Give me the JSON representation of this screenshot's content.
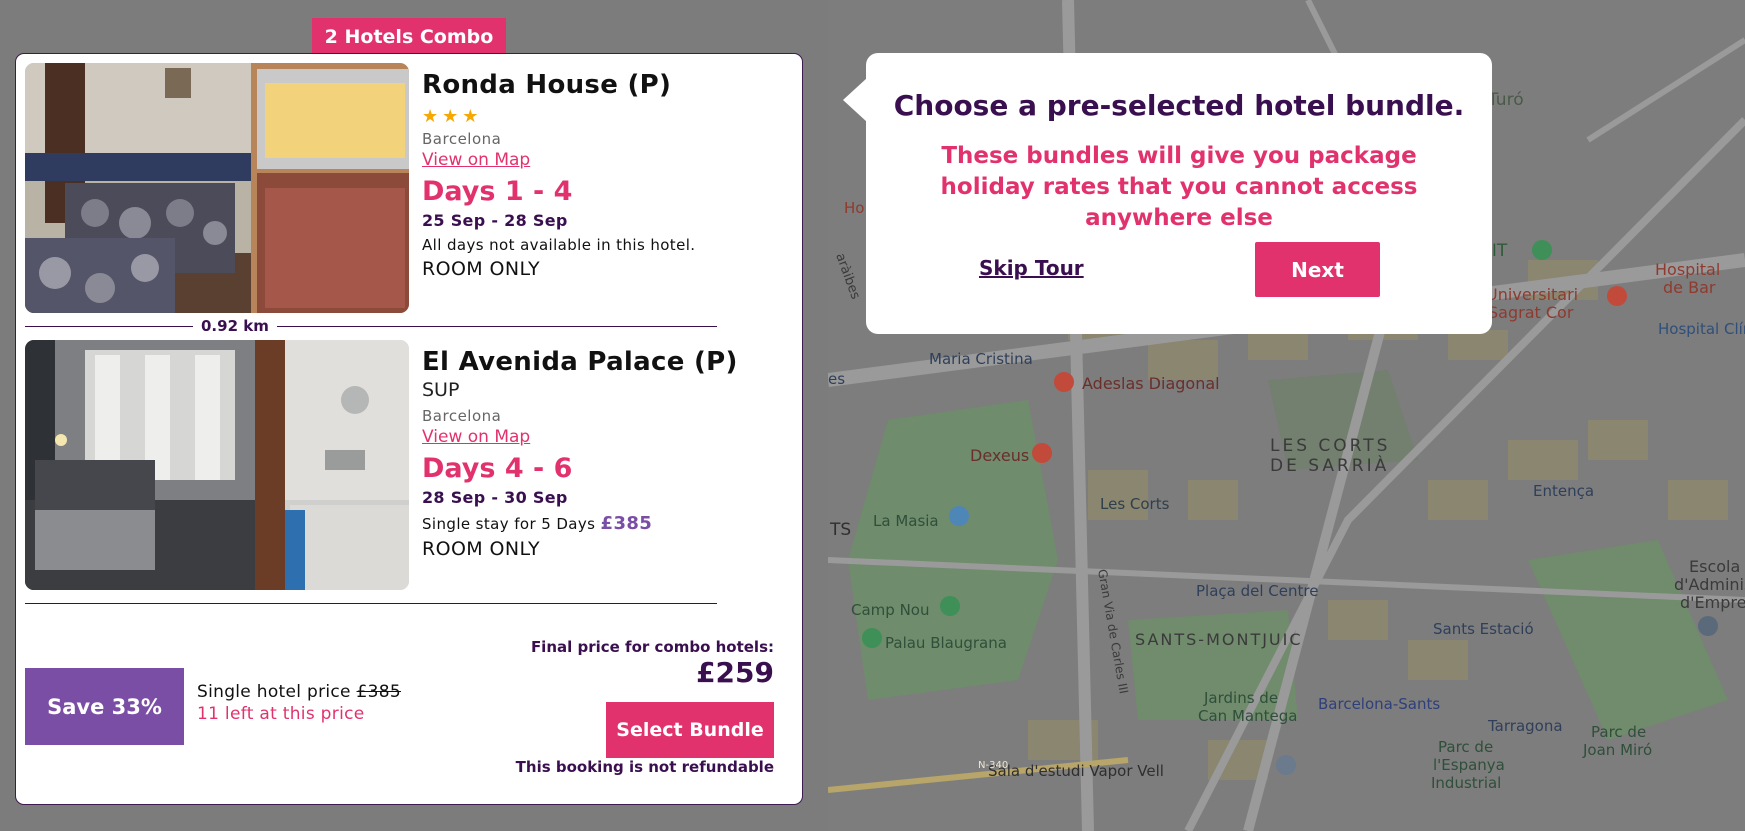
{
  "combo_tag": "2 Hotels Combo",
  "hotels": [
    {
      "name": "Ronda House (P)",
      "stars": "★★★",
      "grade": "",
      "city": "Barcelona",
      "map_link": "View on Map",
      "days": "Days 1 - 4",
      "dates": "25 Sep - 28 Sep",
      "note": "All days not available in this hotel.",
      "note_price": "",
      "board": "ROOM ONLY"
    },
    {
      "name": "El Avenida Palace (P)",
      "stars": "",
      "grade": "SUP",
      "city": "Barcelona",
      "map_link": "View on Map",
      "days": "Days 4 - 6",
      "dates": "28 Sep - 30 Sep",
      "note": "Single stay for 5 Days",
      "note_price": "£385",
      "board": "ROOM ONLY"
    }
  ],
  "distance": "0.92 km",
  "footer": {
    "save_label": "Save 33%",
    "single_price_label": "Single hotel price",
    "single_price_value": "£385",
    "left_count": "11 left at this price",
    "final_label": "Final price for combo hotels:",
    "final_price": "£259",
    "select_button": "Select Bundle",
    "refund_note": "This booking is not refundable"
  },
  "tour": {
    "title": "Choose a pre-selected hotel bundle.",
    "subtitle": "These bundles will give you package holiday rates that you cannot access anywhere else",
    "skip_label": "Skip Tour",
    "next_label": "Next"
  },
  "map": {
    "labels": {
      "turo": "Turó",
      "fit": "icFIT",
      "hospital_uni_1": "ital Universitari",
      "hospital_uni_2": "Sagrat Cor",
      "hospital_1": "Hospital",
      "hospital_2": "de Bar",
      "hospital_cli": "Hospital Clín",
      "maria_cristina": "Maria Cristina",
      "adeslas": "Adeslas Diagonal",
      "dexeus": "Dexeus",
      "les_corts_district_1": "LES CORTS",
      "les_corts_district_2": "DE SARRIÀ",
      "la_masia": "La Masia",
      "les_corts": "Les Corts",
      "entenca": "Entença",
      "camp_nou": "Camp Nou",
      "placa_centre": "Plaça del Centre",
      "palau_blaugrana": "Palau Blaugrana",
      "santsmontjuic": "SANTS-MONTJUIC",
      "sants_estacio": "Sants Estació",
      "escola_1": "Escola",
      "escola_2": "d'Administra",
      "escola_3": "d'Empresé",
      "jardins_1": "Jardins de",
      "jardins_2": "Can Mantega",
      "barcelona_sants": "Barcelona-Sants",
      "tarragona": "Tarragona",
      "parc_espanya_1": "Parc de",
      "parc_espanya_2": "l'Espanya",
      "parc_espanya_3": "Industrial",
      "parc_miro_1": "Parc de",
      "parc_miro_2": "Joan Miró",
      "sala_vapor": "Sala d'estudi Vapor Vell",
      "road_n340": "N-340",
      "edge_ts": "TS",
      "edge_ho": "Ho",
      "edge_es": "es",
      "edge_raibes": "aràibes",
      "street_granvia": "Gran Via de Carles III"
    },
    "colors": {
      "land": "#7d7d7d",
      "park": "#6f8c6c",
      "block": "#8a8670",
      "road": "#8f8f8f"
    }
  }
}
